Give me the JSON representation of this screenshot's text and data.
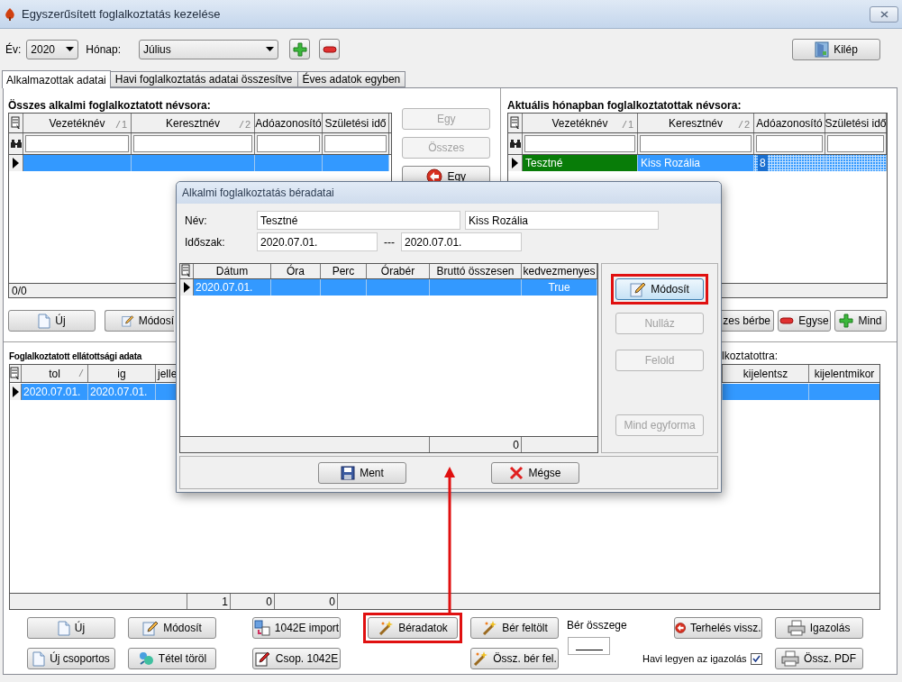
{
  "window": {
    "title": "Egyszerűsített foglalkoztatás kezelése"
  },
  "toolbar": {
    "year_label": "Év:",
    "year": "2020",
    "month_label": "Hónap:",
    "month": "Július",
    "exit_button": "Kilép"
  },
  "tabs": [
    {
      "label": "Alkalmazottak adatai",
      "selected": true
    },
    {
      "label": "Havi foglalkoztatás adatai összesítve",
      "selected": false
    },
    {
      "label": "Éves adatok egyben",
      "selected": false
    }
  ],
  "left_panel": {
    "heading": "Összes alkalmi foglalkoztatott névsora:",
    "columns": [
      {
        "label": "Vezetéknév",
        "sorted": true,
        "sort_index": "1"
      },
      {
        "label": "Keresztnév",
        "sorted": true,
        "sort_index": "2"
      },
      {
        "label": "Adóazonosító",
        "sorted": false
      },
      {
        "label": "Születési idő",
        "sorted": false
      }
    ],
    "rows": [
      {
        "selected": true
      }
    ],
    "status": "0/0",
    "buttons": [
      "Új",
      "Módosí"
    ]
  },
  "transfer_buttons": [
    {
      "label": "Egy",
      "disabled": true
    },
    {
      "label": "Összes",
      "disabled": true
    },
    {
      "label": "Egy",
      "disabled": false
    }
  ],
  "right_panel": {
    "heading": "Aktuális hónapban foglalkoztatottak névsora:",
    "columns": [
      {
        "label": "Vezetéknév",
        "sorted": true,
        "sort_index": "1"
      },
      {
        "label": "Keresztnév",
        "sorted": true,
        "sort_index": "2"
      },
      {
        "label": "Adóazonosító",
        "sorted": false
      },
      {
        "label": "Születési idő",
        "sorted": false
      }
    ],
    "rows": [
      {
        "cells": [
          "Tesztné",
          "Kiss Rozália",
          "8"
        ],
        "selected": true,
        "redacted": true
      }
    ],
    "buttons": [
      "zes bérbe",
      "Egyse",
      "Mind"
    ]
  },
  "bottom_panel": {
    "heading": "Foglalkoztatott ellátottsági adata",
    "right_heading": "lkoztatottra:",
    "left_columns": [
      {
        "label": "tol",
        "sorted": true
      },
      {
        "label": "ig",
        "sorted": false
      },
      {
        "label": "jelle"
      }
    ],
    "right_columns": [
      {
        "label": "kijelentsz"
      },
      {
        "label": "kijelentmikor"
      }
    ],
    "rows": [
      {
        "cells": [
          "2020.07.01.",
          "2020.07.01."
        ],
        "selected": true
      }
    ],
    "footer": [
      "1",
      "0",
      "0"
    ]
  },
  "bottom_toolbar": [
    [
      {
        "kind": "button",
        "label": "Új"
      },
      {
        "kind": "button",
        "label": "Új csoportos"
      }
    ],
    [
      {
        "kind": "button",
        "label": "Módosít"
      },
      {
        "kind": "button",
        "label": "Tétel töröl"
      }
    ],
    [
      {
        "kind": "button",
        "label": "1042E import"
      },
      {
        "kind": "button",
        "label": "Csop. 1042E"
      }
    ],
    [
      {
        "kind": "button",
        "label": "Béradatok",
        "highlighted": true
      }
    ],
    [
      {
        "kind": "button",
        "label": "Bér feltölt"
      },
      {
        "kind": "button",
        "label": "Össz. bér fel."
      }
    ],
    [
      {
        "kind": "amount",
        "label": "Bér összege"
      }
    ],
    [
      {
        "kind": "button",
        "label": "Terhelés vissz."
      },
      {
        "kind": "checkbox",
        "label": "Havi legyen az igazolás",
        "checked": true
      }
    ],
    [
      {
        "kind": "button",
        "label": "Igazolás"
      },
      {
        "kind": "button",
        "label": "Össz. PDF"
      }
    ]
  ],
  "dialog": {
    "title": "Alkalmi foglalkoztatás béradatai",
    "name_label": "Név:",
    "last_name": "Tesztné",
    "first_name": "Kiss Rozália",
    "period_label": "Időszak:",
    "period_from": "2020.07.01.",
    "separator": "---",
    "period_to": "2020.07.01.",
    "columns": [
      "Dátum",
      "Óra",
      "Perc",
      "Órabér",
      "Bruttó összesen",
      "kedvezmenyes"
    ],
    "rows": [
      {
        "date": "2020.07.01.",
        "discounted": "True",
        "selected": true
      }
    ],
    "total": "0",
    "side_buttons": [
      {
        "label": "Módosít",
        "disabled": false,
        "focused": true,
        "highlighted": true
      },
      {
        "label": "Nulláz",
        "disabled": true,
        "focused": false,
        "highlighted": false
      },
      {
        "label": "Felold",
        "disabled": true,
        "focused": false,
        "highlighted": false
      },
      {
        "label": "Mind egyforma",
        "disabled": true,
        "focused": false,
        "highlighted": false
      }
    ],
    "buttons": [
      "Ment",
      "Mégse"
    ]
  },
  "annotation": {
    "arrow": true
  }
}
